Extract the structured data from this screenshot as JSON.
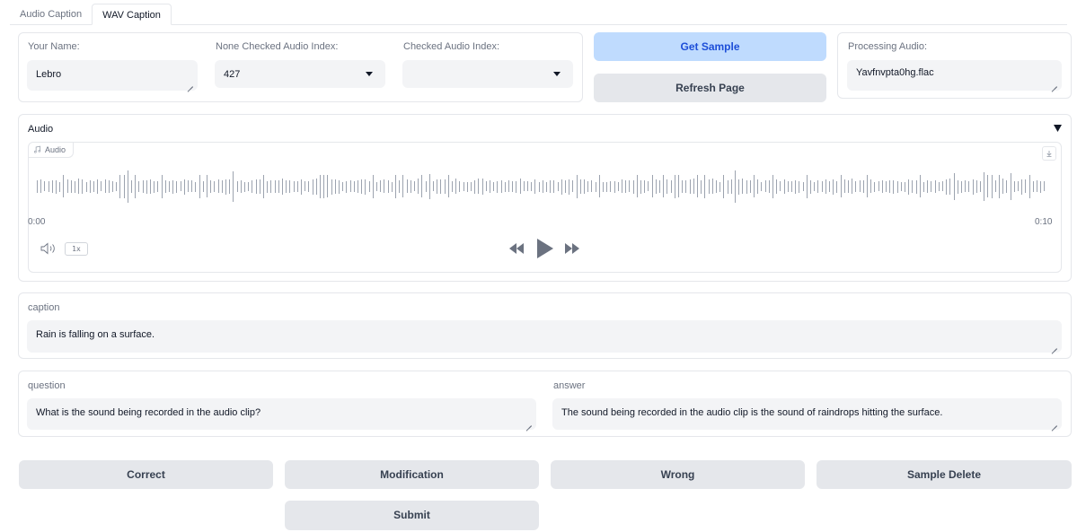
{
  "tabs": [
    "Audio Caption",
    "WAV Caption"
  ],
  "form": {
    "name_label": "Your Name:",
    "name_value": "Lebro",
    "unchecked_label": "None Checked Audio Index:",
    "unchecked_value": "427",
    "checked_label": "Checked Audio Index:",
    "checked_value": "",
    "processing_label": "Processing Audio:",
    "processing_value": "Yavfnvpta0hg.flac"
  },
  "buttons": {
    "get_sample": "Get Sample",
    "refresh": "Refresh Page",
    "correct": "Correct",
    "modification": "Modification",
    "wrong": "Wrong",
    "sample_delete": "Sample Delete",
    "submit": "Submit"
  },
  "audio": {
    "section_label": "Audio",
    "chip_label": "Audio",
    "time_start": "0:00",
    "time_end": "0:10",
    "speed": "1x",
    "icons": [
      "music-note-icon",
      "download-icon",
      "volume-icon",
      "rewind-icon",
      "play-icon",
      "fast-forward-icon",
      "collapse-triangle-icon"
    ]
  },
  "caption": {
    "label": "caption",
    "value": "Rain is falling on a surface."
  },
  "qa": {
    "question_label": "question",
    "question_value": "What is the sound being recorded in the audio clip?",
    "answer_label": "answer",
    "answer_value": "The sound being recorded in the audio clip is the sound of raindrops hitting the surface."
  },
  "colors": {
    "primary_button_bg": "#bfdbfe",
    "primary_button_text": "#1d4ed8",
    "button_bg": "#e5e7eb",
    "field_bg": "#f3f4f6",
    "waveform": "#9ca3af"
  }
}
